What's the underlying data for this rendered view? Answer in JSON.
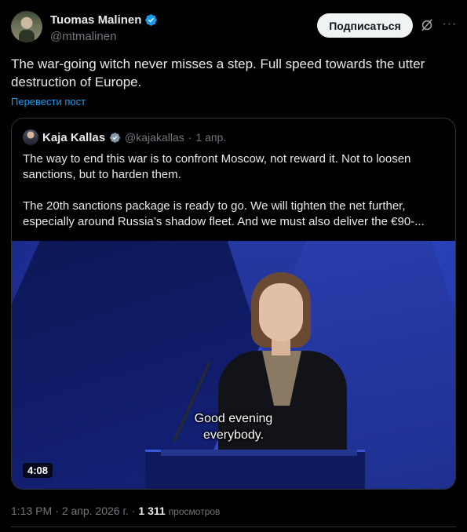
{
  "author": {
    "display_name": "Tuomas Malinen",
    "handle": "@mtmalinen"
  },
  "actions": {
    "follow_label": "Подписаться",
    "more_label": "···"
  },
  "post": {
    "text": "The war-going witch never misses a step. Full speed towards the utter destruction of Europe.",
    "translate_label": "Перевести пост"
  },
  "quoted": {
    "display_name": "Kaja Kallas",
    "handle": "@kajakallas",
    "separator": "·",
    "date": "1 апр.",
    "paragraph_1": "The way to end this war is to confront Moscow, not reward it. Not to loosen sanctions, but to harden them.",
    "paragraph_2": "The 20th sanctions package is ready to go. We will tighten the net further, especially around Russia’s shadow fleet. And we must also deliver the €90-...",
    "video": {
      "subtitle_line_1": "Good evening",
      "subtitle_line_2": "everybody.",
      "duration": "4:08"
    }
  },
  "meta": {
    "time": "1:13 PM",
    "separator_1": "·",
    "date": "2 апр. 2026 г.",
    "separator_2": "·",
    "views_count": "1 311",
    "views_label": "просмотров"
  },
  "colors": {
    "background": "#000000",
    "text": "#e7e9ea",
    "muted": "#71767b",
    "link": "#1d9bf0",
    "verified": "#1d9bf0",
    "border": "#2f3336"
  },
  "icons": {
    "verified": "verified-badge-icon",
    "grok": "grok-icon",
    "more": "more-icon"
  }
}
